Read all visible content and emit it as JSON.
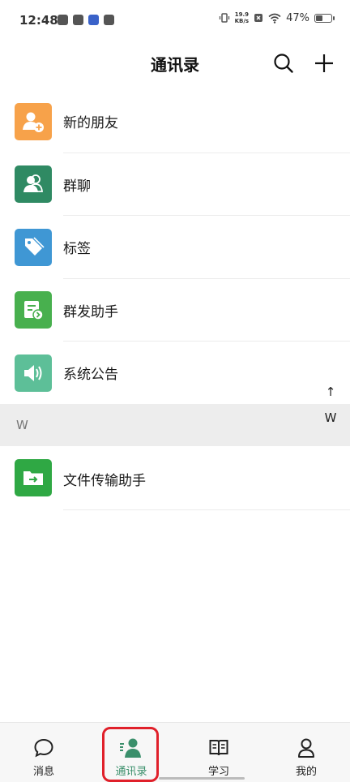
{
  "status_bar": {
    "time": "12:48",
    "network_speed_value": "19.9",
    "network_speed_unit": "KB/s",
    "battery_percent": "47%",
    "battery_level": 0.47
  },
  "header": {
    "title": "通讯录",
    "search_icon": "search-icon",
    "add_icon": "plus-icon"
  },
  "contacts_menu": [
    {
      "label": "新的朋友",
      "icon": "add-friend-icon",
      "color": "#f7a24a"
    },
    {
      "label": "群聊",
      "icon": "group-chat-icon",
      "color": "#2f8a63"
    },
    {
      "label": "标签",
      "icon": "tag-icon",
      "color": "#3f97d4"
    },
    {
      "label": "群发助手",
      "icon": "broadcast-icon",
      "color": "#48b04e"
    },
    {
      "label": "系统公告",
      "icon": "speaker-icon",
      "color": "#5dbf98"
    }
  ],
  "section": {
    "letter": "W",
    "items": [
      {
        "label": "文件传输助手",
        "icon": "file-transfer-icon",
        "color": "#2fa844"
      }
    ]
  },
  "index_bar": {
    "up_arrow": "↑",
    "letter": "W"
  },
  "bottom_nav": [
    {
      "label": "消息",
      "icon": "chat-bubble-icon",
      "active": false
    },
    {
      "label": "通讯录",
      "icon": "contacts-icon",
      "active": true
    },
    {
      "label": "学习",
      "icon": "book-icon",
      "active": false
    },
    {
      "label": "我的",
      "icon": "person-icon",
      "active": false
    }
  ],
  "colors": {
    "accent": "#3a8f6b",
    "highlight": "#e0202a",
    "section_bg": "#ededed"
  }
}
